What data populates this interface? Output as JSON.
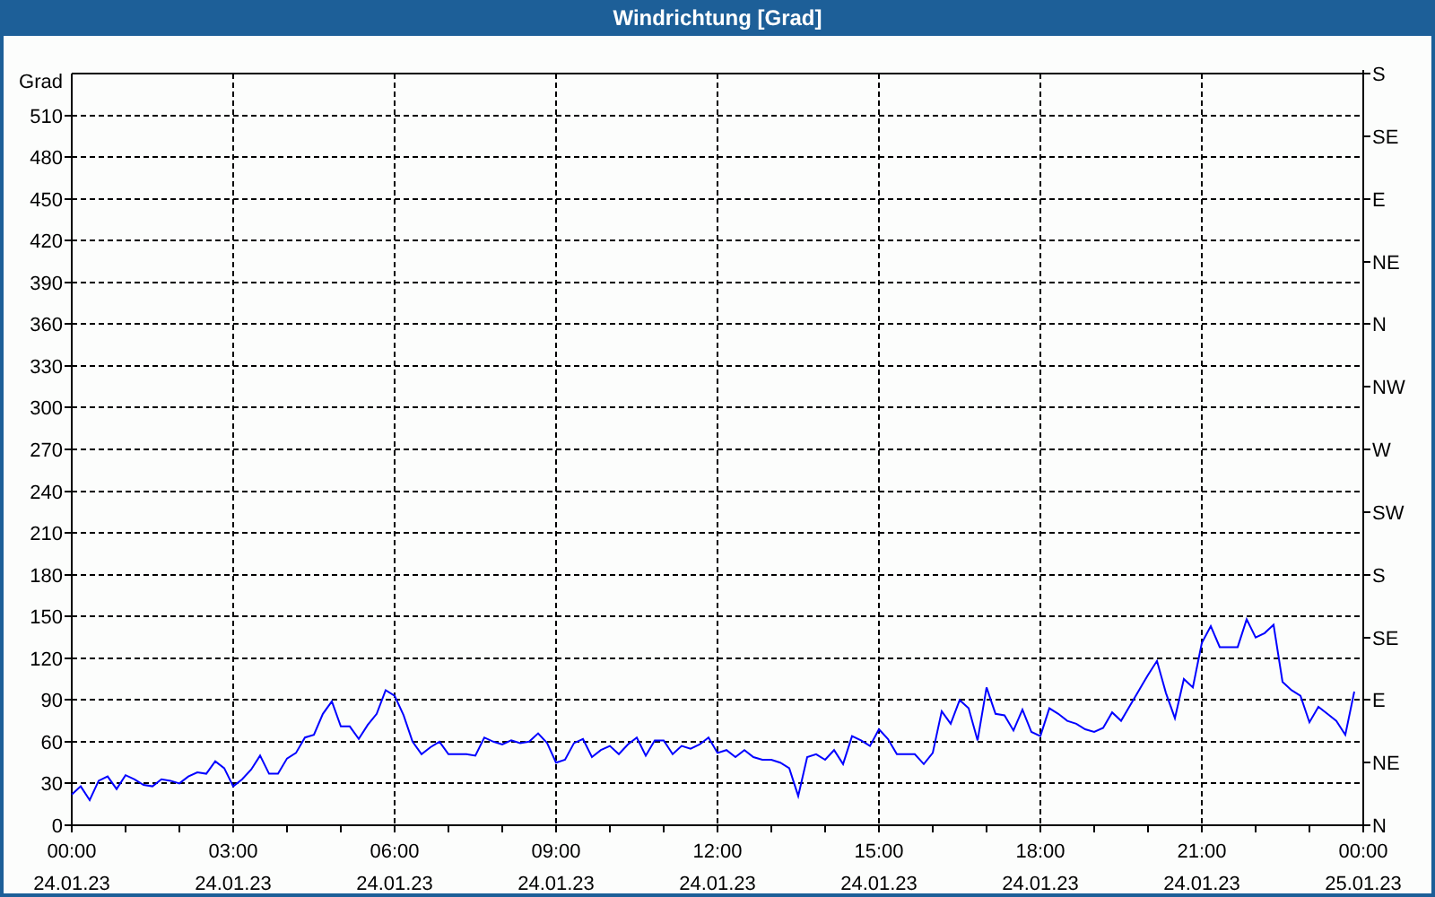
{
  "window": {
    "title": "Windrichtung [Grad]"
  },
  "chart_data": {
    "type": "line",
    "ylabel": "Grad",
    "grid": true,
    "ylim": [
      0,
      540
    ],
    "categories": [
      "00:00",
      null,
      null,
      null,
      null,
      null,
      null,
      null,
      null,
      null,
      null,
      null,
      null,
      null,
      null,
      null,
      null,
      null,
      "03:00",
      null,
      null,
      null,
      null,
      null,
      null,
      null,
      null,
      null,
      null,
      null,
      null,
      null,
      null,
      null,
      null,
      null,
      "06:00",
      null,
      null,
      null,
      null,
      null,
      null,
      null,
      null,
      null,
      null,
      null,
      null,
      null,
      null,
      null,
      null,
      null,
      "09:00",
      null,
      null,
      null,
      null,
      null,
      null,
      null,
      null,
      null,
      null,
      null,
      null,
      null,
      null,
      null,
      null,
      null,
      "12:00",
      null,
      null,
      null,
      null,
      null,
      null,
      null,
      null,
      null,
      null,
      null,
      null,
      null,
      null,
      null,
      null,
      null,
      "15:00",
      null,
      null,
      null,
      null,
      null,
      null,
      null,
      null,
      null,
      null,
      null,
      null,
      null,
      null,
      null,
      null,
      null,
      "18:00",
      null,
      null,
      null,
      null,
      null,
      null,
      null,
      null,
      null,
      null,
      null,
      null,
      null,
      null,
      null,
      null,
      null,
      "21:00",
      null,
      null,
      null,
      null,
      null,
      null,
      null,
      null,
      null,
      null,
      null,
      null,
      null,
      null,
      null,
      null,
      null,
      "00:00"
    ],
    "yticks": [
      0,
      30,
      60,
      90,
      120,
      150,
      180,
      210,
      240,
      270,
      300,
      330,
      360,
      390,
      420,
      450,
      480,
      510
    ],
    "series": [
      {
        "color": "#0000ff",
        "values": [
          22,
          28,
          18,
          32,
          35,
          26,
          36,
          33,
          29,
          28,
          33,
          32,
          30,
          35,
          38,
          37,
          46,
          41,
          28,
          33,
          40,
          50,
          37,
          37,
          48,
          52,
          63,
          65,
          80,
          89,
          71,
          71,
          62,
          72,
          80,
          97,
          93,
          79,
          60,
          51,
          56,
          60,
          51,
          51,
          51,
          50,
          63,
          60,
          58,
          61,
          59,
          60,
          66,
          59,
          45,
          47,
          59,
          62,
          49,
          54,
          57,
          51,
          58,
          63,
          50,
          61,
          61,
          51,
          57,
          55,
          58,
          63,
          52,
          54,
          49,
          54,
          49,
          47,
          47,
          45,
          41,
          21,
          49,
          51,
          47,
          54,
          44,
          64,
          61,
          57,
          69,
          62,
          51,
          51,
          51,
          44,
          52,
          82,
          73,
          90,
          84,
          61,
          99,
          80,
          79,
          68,
          83,
          67,
          64,
          84,
          80,
          75,
          73,
          69,
          67,
          70,
          81,
          75,
          86,
          97,
          108,
          118,
          95,
          77,
          105,
          99,
          131,
          143,
          128,
          128,
          128,
          148,
          135,
          138,
          144,
          103,
          97,
          93,
          74,
          85,
          80,
          75,
          65,
          96,
          null
        ]
      }
    ]
  },
  "x_axis_dates": [
    "24.01.23",
    "24.01.23",
    "24.01.23",
    "24.01.23",
    "24.01.23",
    "24.01.23",
    "24.01.23",
    "24.01.23",
    "25.01.23"
  ],
  "right_axis": [
    "S",
    "SE",
    "E",
    "NE",
    "N",
    "NW",
    "W",
    "SW",
    "S",
    "SE",
    "E",
    "NE",
    "N"
  ]
}
